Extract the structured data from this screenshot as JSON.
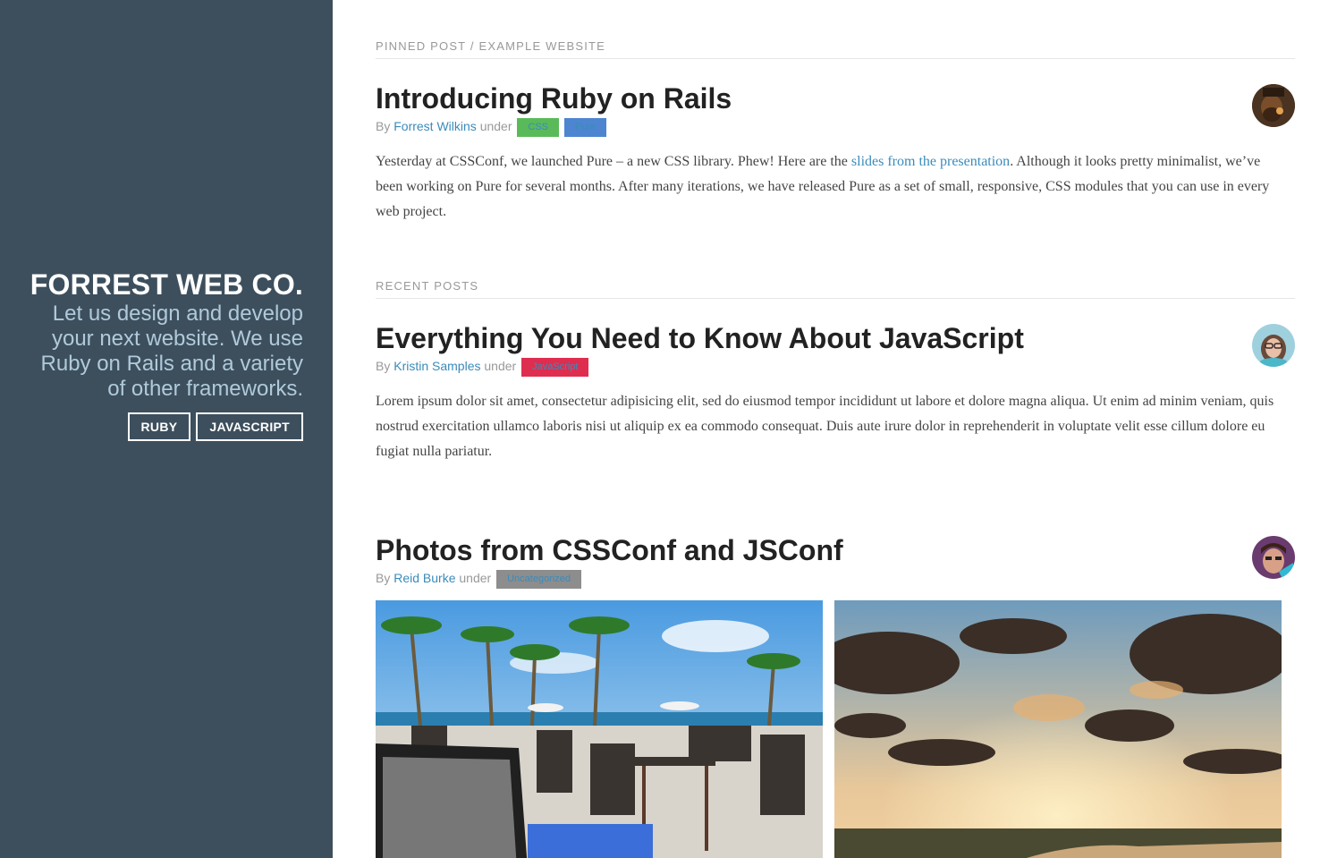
{
  "sidebar": {
    "brand_title": "FORREST WEB CO.",
    "tagline": "Let us design and develop your next website. We use Ruby on Rails and a variety of other frameworks.",
    "nav": [
      {
        "label": "RUBY"
      },
      {
        "label": "JAVASCRIPT"
      }
    ]
  },
  "pinned": {
    "header": "PINNED POST / EXAMPLE WEBSITE",
    "post": {
      "title": "Introducing Ruby on Rails",
      "by": "By",
      "author": "Forrest Wilkins",
      "under": "under",
      "tags": [
        {
          "label": "CSS",
          "color": "#5aba59"
        },
        {
          "label": "Pure",
          "color": "#4d85d1"
        }
      ],
      "body_before": "Yesterday at CSSConf, we launched Pure – a new CSS library. Phew! Here are the ",
      "body_link": "slides from the presentation",
      "body_after": ". Although it looks pretty minimalist, we’ve been working on Pure for several months. After many iterations, we have released Pure as a set of small, responsive, CSS modules that you can use in every web project."
    }
  },
  "recent": {
    "header": "RECENT POSTS",
    "posts": [
      {
        "title": "Everything You Need to Know About JavaScript",
        "by": "By",
        "author": "Kristin Samples",
        "under": "under",
        "tags": [
          {
            "label": "JavaScript",
            "color": "#df2d4f"
          }
        ],
        "body": "Lorem ipsum dolor sit amet, consectetur adipisicing elit, sed do eiusmod tempor incididunt ut labore et dolore magna aliqua. Ut enim ad minim veniam, quis nostrud exercitation ullamco laboris nisi ut aliquip ex ea commodo consequat. Duis aute irure dolor in reprehenderit in voluptate velit esse cillum dolore eu fugiat nulla pariatur."
      },
      {
        "title": "Photos from CSSConf and JSConf",
        "by": "By",
        "author": "Reid Burke",
        "under": "under",
        "tags": [
          {
            "label": "Uncategorized",
            "color": "#8d8d8d"
          }
        ]
      }
    ]
  },
  "colors": {
    "sidebar_bg": "#3d4f5d",
    "link": "#3b8bba",
    "tagline": "#b0cadb"
  }
}
